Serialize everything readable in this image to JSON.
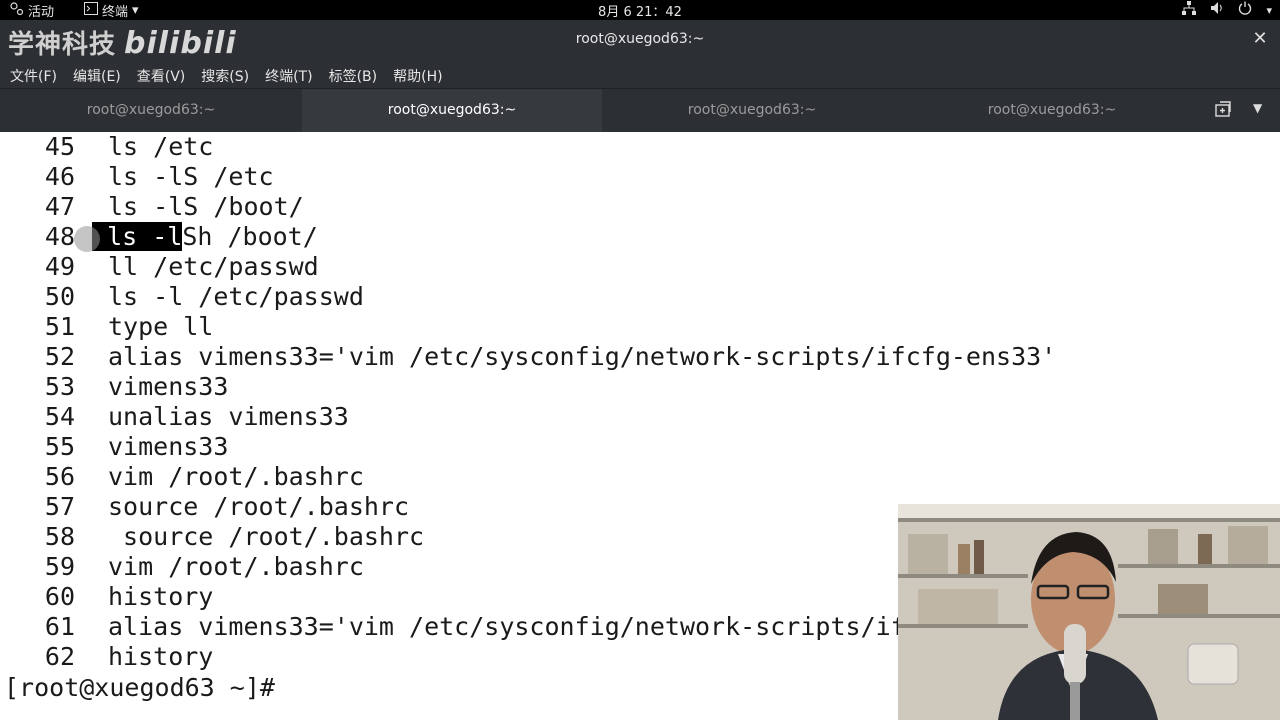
{
  "topbar": {
    "activities": "活动",
    "app_menu": "终端",
    "clock": "8月 6  21：42"
  },
  "window": {
    "title": "root@xuegod63:~",
    "logo_text": "学神科技",
    "logo_brand": "bilibili"
  },
  "menu": [
    "文件(F)",
    "编辑(E)",
    "查看(V)",
    "搜索(S)",
    "终端(T)",
    "标签(B)",
    "帮助(H)"
  ],
  "tabs": [
    {
      "label": "root@xuegod63:~",
      "active": false
    },
    {
      "label": "root@xuegod63:~",
      "active": true
    },
    {
      "label": "root@xuegod63:~",
      "active": false
    },
    {
      "label": "root@xuegod63:~",
      "active": false
    }
  ],
  "terminal": {
    "lines": [
      {
        "num": "45",
        "cmd": "ls /etc"
      },
      {
        "num": "46",
        "cmd": "ls -lS /etc"
      },
      {
        "num": "47",
        "cmd": "ls -lS /boot/"
      },
      {
        "num": "48",
        "cmd_selected": "ls -l",
        "cmd_rest": "Sh /boot/"
      },
      {
        "num": "49",
        "cmd": "ll /etc/passwd"
      },
      {
        "num": "50",
        "cmd": "ls -l /etc/passwd"
      },
      {
        "num": "51",
        "cmd": "type ll"
      },
      {
        "num": "52",
        "cmd": "alias vimens33='vim /etc/sysconfig/network-scripts/ifcfg-ens33'"
      },
      {
        "num": "53",
        "cmd": "vimens33"
      },
      {
        "num": "54",
        "cmd": "unalias vimens33"
      },
      {
        "num": "55",
        "cmd": "vimens33"
      },
      {
        "num": "56",
        "cmd": "vim /root/.bashrc"
      },
      {
        "num": "57",
        "cmd": "source /root/.bashrc"
      },
      {
        "num": "58",
        "cmd": " source /root/.bashrc"
      },
      {
        "num": "59",
        "cmd": "vim /root/.bashrc"
      },
      {
        "num": "60",
        "cmd": "history"
      },
      {
        "num": "61",
        "cmd": "alias vimens33='vim /etc/sysconfig/network-scripts/if"
      },
      {
        "num": "62",
        "cmd": "history"
      }
    ],
    "prompt": "[root@xuegod63 ~]#"
  }
}
